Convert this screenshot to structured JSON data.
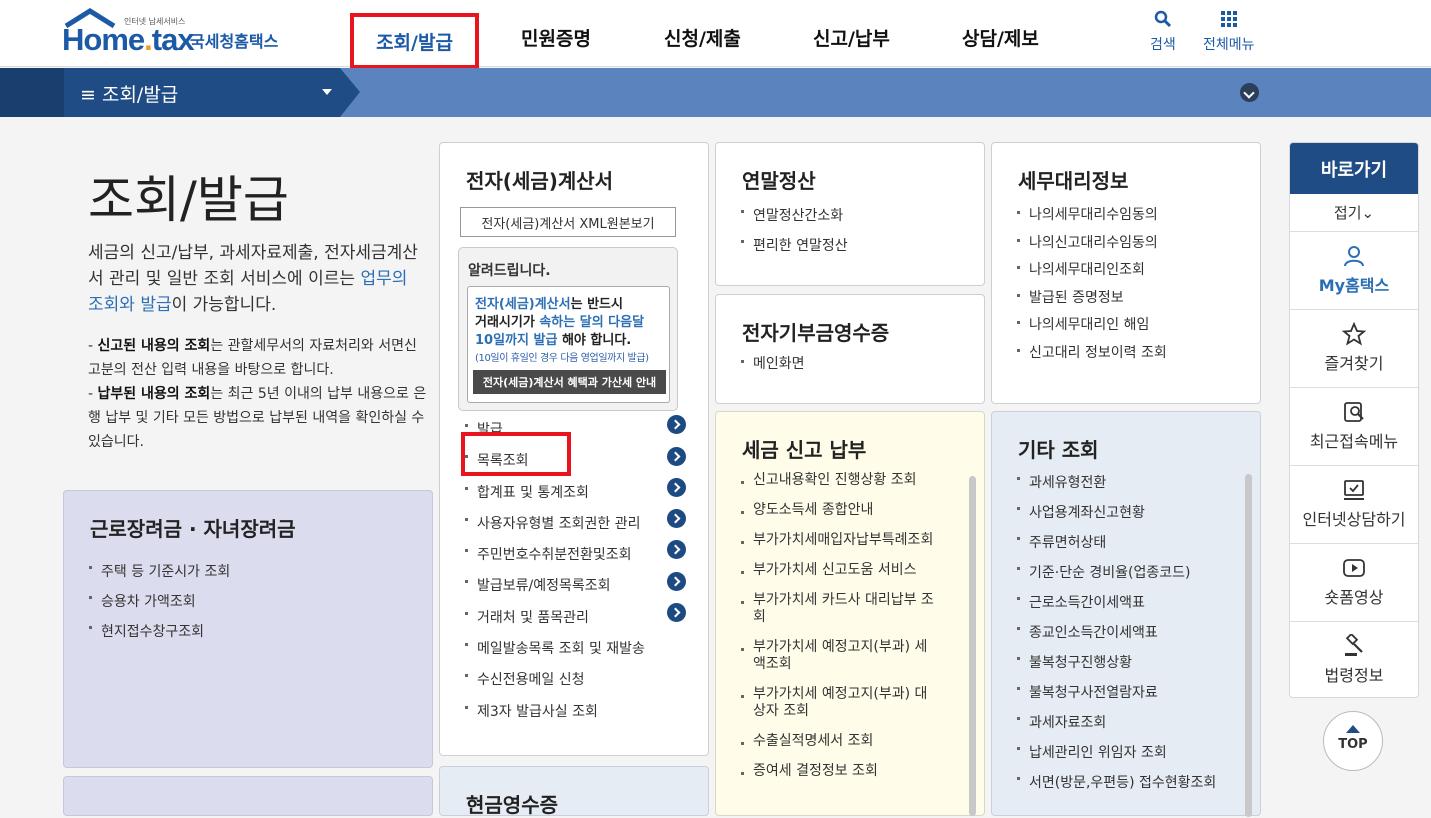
{
  "header": {
    "logo_small": "인터넷 납세서비스",
    "logo_brand_a": "Home",
    "logo_brand_dot": ".",
    "logo_brand_b": "tax",
    "logo_korean": "국세청홈택스",
    "nav": [
      "조회/발급",
      "민원증명",
      "신청/제출",
      "신고/납부",
      "상담/제보"
    ],
    "search_label": "검색",
    "menu_label": "전체메뉴"
  },
  "subbar": {
    "title": "조회/발급"
  },
  "intro": {
    "title": "조회/발급",
    "desc_a": "세금의 신고/납부, 과세자료제출, 전자세금계산서 관리 및 일반 조회 서비스에 이르는 ",
    "desc_hl": "업무의 조회와 발급",
    "desc_b": "이 가능합니다.",
    "note1_bold": "신고된 내용의 조회",
    "note1_rest": "는 관할세무서의 자료처리와 서면신고분의 전산 입력 내용을 바탕으로 합니다.",
    "note2_bold": "납부된 내용의 조회",
    "note2_rest": "는 최근 5년 이내의 납부 내용으로 은행 납부 및 기타 모든 방법으로 납부된 내역을 확인하실 수 있습니다."
  },
  "card_labor": {
    "title": "근로장려금 · 자녀장려금",
    "items": [
      "주택 등 기준시가 조회",
      "승용차 가액조회",
      "현지접수창구조회"
    ]
  },
  "card_einvoice": {
    "title": "전자(세금)계산서",
    "xml_button": "전자(세금)계산서 XML원본보기",
    "notice_title": "알려드립니다.",
    "notice_l1a": "전자(세금)계산서",
    "notice_l1b": "는 반드시",
    "notice_l2a": "거래시기가 ",
    "notice_l2b": "속하는 달의 다음달",
    "notice_l3a": "10일까지 발급",
    "notice_l3b": " 해야 합니다.",
    "notice_small": "(10일이 휴일인 경우 다음 영업일까지 발급)",
    "notice_bar": "전자(세금)계산서 혜택과 가산세 안내",
    "items": [
      "발급",
      "목록조회",
      "합계표 및 통계조회",
      "사용자유형별 조회권한 관리",
      "주민번호수취분전환및조회",
      "발급보류/예정목록조회",
      "거래처 및 품목관리",
      "메일발송목록 조회 및 재발송",
      "수신전용메일 신청",
      "제3자 발급사실 조회"
    ]
  },
  "card_yearend": {
    "title": "연말정산",
    "items": [
      "연말정산간소화",
      "편리한 연말정산"
    ]
  },
  "card_donation": {
    "title": "전자기부금영수증",
    "items": [
      "메인화면"
    ]
  },
  "card_agent": {
    "title": "세무대리정보",
    "items": [
      "나의세무대리수임동의",
      "나의신고대리수임동의",
      "나의세무대리인조회",
      "발급된 증명정보",
      "나의세무대리인 해임",
      "신고대리 정보이력 조회"
    ]
  },
  "card_tax": {
    "title": "세금 신고 납부",
    "items": [
      "신고내용확인 진행상황 조회",
      "양도소득세 종합안내",
      "부가가치세매입자납부특례조회",
      "부가가치세 신고도움 서비스",
      "부가가치세 카드사 대리납부 조\n회",
      "부가가치세 예정고지(부과) 세\n액조회",
      "부가가치세 예정고지(부과) 대\n상자 조회",
      "수출실적명세서 조회",
      "증여세 결정정보 조회"
    ]
  },
  "card_other": {
    "title": "기타 조회",
    "items": [
      "과세유형전환",
      "사업용계좌신고현황",
      "주류면허상태",
      "기준·단순 경비율(업종코드)",
      "근로소득간이세액표",
      "종교인소득간이세액표",
      "불복청구진행상황",
      "불복청구사전열람자료",
      "과세자료조회",
      "납세관리인 위임자 조회",
      "서면(방문,우편등) 접수현황조회"
    ]
  },
  "card_cash": {
    "title": "현금영수증"
  },
  "quick": {
    "head": "바로가기",
    "fold": "접기",
    "items": [
      "My홈택스",
      "즐겨찾기",
      "최근접속메뉴",
      "인터넷상담하기",
      "숏폼영상",
      "법령정보"
    ],
    "icons": [
      "person-icon",
      "star-icon",
      "recent-icon",
      "monitor-icon",
      "play-icon",
      "gavel-icon"
    ],
    "top": "TOP"
  },
  "colors": {
    "brand": "#1c5aa8",
    "highlight": "#e8141e",
    "navy": "#1f4c84"
  }
}
